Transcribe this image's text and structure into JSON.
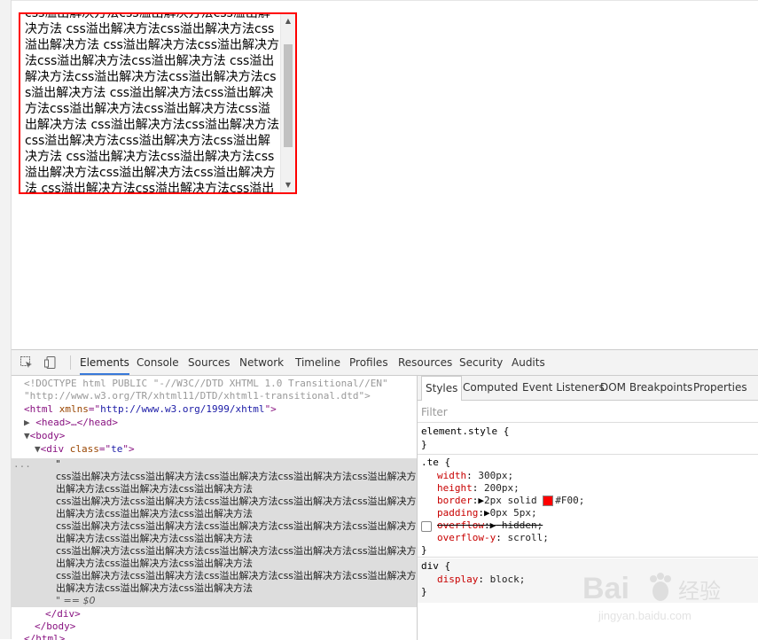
{
  "page": {
    "overflow_text": "css溢出解决方法css溢出解决方法css溢出解决方法 css溢出解决方法css溢出解决方法css溢出解决方法 css溢出解决方法css溢出解决方法css溢出解决方法css溢出解决方法 css溢出解决方法css溢出解决方法css溢出解决方法css溢出解决方法 css溢出解决方法css溢出解决方法css溢出解决方法css溢出解决方法css溢出解决方法 css溢出解决方法css溢出解决方法css溢出解决方法css溢出解决方法css溢出解决方法 css溢出解决方法css溢出解决方法css溢出解决方法css溢出解决方法css溢出解决方法 css溢出解决方法css溢出解决方法css溢出解决方法css溢出解决方法"
  },
  "devtools": {
    "tabs": [
      "Elements",
      "Console",
      "Sources",
      "Network",
      "Timeline",
      "Profiles",
      "Resources",
      "Security",
      "Audits"
    ],
    "active_tab": "Elements",
    "dom": {
      "doctype1": "<!DOCTYPE html PUBLIC \"-//W3C//DTD XHTML 1.0 Transitional//EN\"",
      "doctype2": "\"http://www.w3.org/TR/xhtml11/DTD/xhtml1-transitional.dtd\">",
      "html_tag": "html",
      "html_attr": "xmlns",
      "html_val": "http://www.w3.org/1999/xhtml",
      "head": "<head>…</head>",
      "body_open": "<body>",
      "div_tag": "div",
      "div_attr": "class",
      "div_val": "te",
      "ellipsis": "...",
      "quote_open": "\"",
      "text_lines": [
        "css溢出解决方法css溢出解决方法css溢出解决方法css溢出解决方法css溢出解决方法",
        "出解决方法css溢出解决方法css溢出解决方法",
        "css溢出解决方法css溢出解决方法css溢出解决方法css溢出解决方法css溢出解决方法",
        "出解决方法css溢出解决方法css溢出解决方法",
        "css溢出解决方法css溢出解决方法css溢出解决方法css溢出解决方法css溢出解决方法",
        "出解决方法css溢出解决方法css溢出解决方法",
        "css溢出解决方法css溢出解决方法css溢出解决方法css溢出解决方法css溢出解决方法",
        "出解决方法css溢出解决方法css溢出解决方法",
        "css溢出解决方法css溢出解决方法css溢出解决方法css溢出解决方法css溢出解决方法",
        "出解决方法css溢出解决方法css溢出解决方法"
      ],
      "quote_close": "\" == $0",
      "div_close": "</div>",
      "body_close": "</body>",
      "html_close": "</html>"
    },
    "styles": {
      "tabs": [
        "Styles",
        "Computed",
        "Event Listeners",
        "DOM Breakpoints",
        "Properties"
      ],
      "filter_placeholder": "Filter",
      "element_style": "element.style {",
      "close_brace": "}",
      "te_selector": ".te {",
      "te_props": [
        {
          "name": "width",
          "value": "300px;"
        },
        {
          "name": "height",
          "value": "200px;"
        },
        {
          "name": "border",
          "value": "2px solid ",
          "color_value": "#F00;"
        },
        {
          "name": "padding",
          "value": "0px 5px;"
        },
        {
          "name": "overflow",
          "value": "hidden;",
          "disabled": true
        },
        {
          "name": "overflow-y",
          "value": "scroll;"
        }
      ],
      "div_selector": "div {",
      "div_prop": {
        "name": "display",
        "value": "block;"
      }
    }
  },
  "watermark": {
    "brand": "Bai",
    "brand2": "经验",
    "url": "jingyan.baidu.com"
  }
}
